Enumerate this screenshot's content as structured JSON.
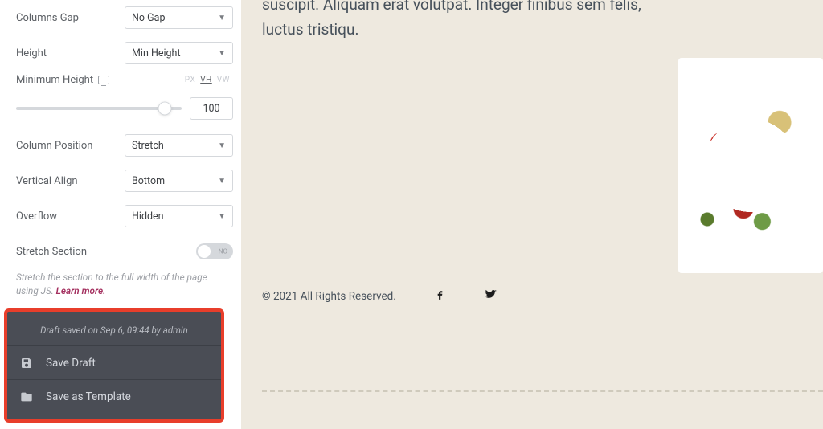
{
  "panel": {
    "columns_gap": {
      "label": "Columns Gap",
      "value": "No Gap"
    },
    "height": {
      "label": "Height",
      "value": "Min Height"
    },
    "min_height": {
      "label": "Minimum Height",
      "units": {
        "px": "PX",
        "vh": "VH",
        "vw": "VW",
        "active": "vh"
      },
      "value": "100",
      "slider_pct": 90
    },
    "column_position": {
      "label": "Column Position",
      "value": "Stretch"
    },
    "vertical_align": {
      "label": "Vertical Align",
      "value": "Bottom"
    },
    "overflow": {
      "label": "Overflow",
      "value": "Hidden"
    },
    "stretch": {
      "label": "Stretch Section",
      "toggle_text": "NO",
      "helper_pre": "Stretch the section to the full width of the page using JS. ",
      "learn_more": "Learn more."
    }
  },
  "footer": {
    "draft_note": "Draft saved on Sep 6, 09:44 by admin",
    "save_draft": "Save Draft",
    "save_template": "Save as Template"
  },
  "canvas": {
    "paragraph": "suscipit. Aliquam erat volutpat. Integer finibus sem felis, luctus tristiqu.",
    "copyright": "© 2021 All Rights Reserved."
  }
}
